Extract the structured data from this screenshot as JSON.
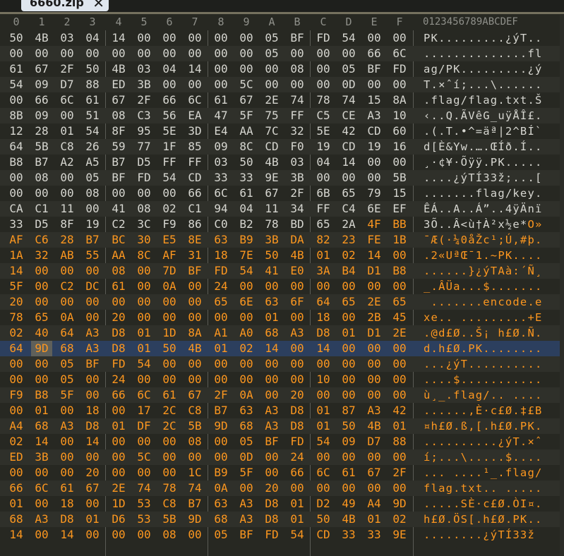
{
  "tab": {
    "title": "6660.zip"
  },
  "header": {
    "columns": [
      "0",
      "1",
      "2",
      "3",
      "4",
      "5",
      "6",
      "7",
      "8",
      "9",
      "A",
      "B",
      "C",
      "D",
      "E",
      "F"
    ],
    "ascii": "0123456789ABCDEF"
  },
  "selection": {
    "row": 20,
    "col": 1
  },
  "rows": [
    {
      "hex": [
        "50",
        "4B",
        "03",
        "04",
        "14",
        "00",
        "00",
        "00",
        "00",
        "00",
        "05",
        "BF",
        "FD",
        "54",
        "00",
        "00"
      ],
      "ascii": "PK.........¿ýT..",
      "orange_from": 16
    },
    {
      "hex": [
        "00",
        "00",
        "00",
        "00",
        "00",
        "00",
        "00",
        "00",
        "00",
        "00",
        "05",
        "00",
        "00",
        "00",
        "66",
        "6C"
      ],
      "ascii": "..............fl",
      "orange_from": 16
    },
    {
      "hex": [
        "61",
        "67",
        "2F",
        "50",
        "4B",
        "03",
        "04",
        "14",
        "00",
        "00",
        "00",
        "08",
        "00",
        "05",
        "BF",
        "FD"
      ],
      "ascii": "ag/PK.........¿ý",
      "orange_from": 16
    },
    {
      "hex": [
        "54",
        "09",
        "D7",
        "88",
        "ED",
        "3B",
        "00",
        "00",
        "00",
        "5C",
        "00",
        "00",
        "00",
        "0D",
        "00",
        "00"
      ],
      "ascii": "T.×ˆí;...\\......",
      "orange_from": 16
    },
    {
      "hex": [
        "00",
        "66",
        "6C",
        "61",
        "67",
        "2F",
        "66",
        "6C",
        "61",
        "67",
        "2E",
        "74",
        "78",
        "74",
        "15",
        "8A"
      ],
      "ascii": ".flag/flag.txt.Š",
      "orange_from": 16
    },
    {
      "hex": [
        "8B",
        "09",
        "00",
        "51",
        "08",
        "C3",
        "56",
        "EA",
        "47",
        "5F",
        "75",
        "FF",
        "C5",
        "CE",
        "A3",
        "10"
      ],
      "ascii": "‹..Q.ÃVêG_uÿÅÎ£.",
      "orange_from": 16
    },
    {
      "hex": [
        "12",
        "28",
        "01",
        "54",
        "8F",
        "95",
        "5E",
        "3D",
        "E4",
        "AA",
        "7C",
        "32",
        "5E",
        "42",
        "CD",
        "60"
      ],
      "ascii": ".(.T.•^=äª|2^BÍ`",
      "orange_from": 16
    },
    {
      "hex": [
        "64",
        "5B",
        "C8",
        "26",
        "59",
        "77",
        "1F",
        "85",
        "09",
        "8C",
        "CD",
        "F0",
        "19",
        "CD",
        "19",
        "16"
      ],
      "ascii": "d[È&Yw.….ŒÍð.Í..",
      "orange_from": 16
    },
    {
      "hex": [
        "B8",
        "B7",
        "A2",
        "A5",
        "B7",
        "D5",
        "FF",
        "FF",
        "03",
        "50",
        "4B",
        "03",
        "04",
        "14",
        "00",
        "00"
      ],
      "ascii": "¸·¢¥·Õÿÿ.PK.....",
      "orange_from": 16
    },
    {
      "hex": [
        "00",
        "08",
        "00",
        "05",
        "BF",
        "FD",
        "54",
        "CD",
        "33",
        "33",
        "9E",
        "3B",
        "00",
        "00",
        "00",
        "5B"
      ],
      "ascii": "....¿ýTÍ33ž;...[",
      "orange_from": 16
    },
    {
      "hex": [
        "00",
        "00",
        "00",
        "08",
        "00",
        "00",
        "00",
        "66",
        "6C",
        "61",
        "67",
        "2F",
        "6B",
        "65",
        "79",
        "15"
      ],
      "ascii": ".......flag/key.",
      "orange_from": 16
    },
    {
      "hex": [
        "CA",
        "C1",
        "11",
        "00",
        "41",
        "08",
        "02",
        "C1",
        "94",
        "04",
        "11",
        "34",
        "FF",
        "C4",
        "6E",
        "EF"
      ],
      "ascii": "ÊÁ..A..Á”..4ÿÄnï",
      "orange_from": 16
    },
    {
      "hex": [
        "33",
        "D5",
        "8F",
        "19",
        "C2",
        "3C",
        "F9",
        "86",
        "C0",
        "B2",
        "78",
        "BD",
        "65",
        "2A",
        "4F",
        "BB"
      ],
      "ascii": "3Õ..Â<ù†À²x½e*O»",
      "orange_from": 14
    },
    {
      "hex": [
        "AF",
        "C6",
        "28",
        "B7",
        "BC",
        "30",
        "E5",
        "8E",
        "63",
        "B9",
        "3B",
        "DA",
        "82",
        "23",
        "FE",
        "1B"
      ],
      "ascii": "¯Æ(·¼0åŽc¹;Ú‚#þ.",
      "orange_from": 0
    },
    {
      "hex": [
        "1A",
        "32",
        "AB",
        "55",
        "AA",
        "8C",
        "AF",
        "31",
        "18",
        "7E",
        "50",
        "4B",
        "01",
        "02",
        "14",
        "00"
      ],
      "ascii": ".2«UªŒ¯1.~PK....",
      "orange_from": 0
    },
    {
      "hex": [
        "14",
        "00",
        "00",
        "00",
        "08",
        "00",
        "7D",
        "BF",
        "FD",
        "54",
        "41",
        "E0",
        "3A",
        "B4",
        "D1",
        "B8"
      ],
      "ascii": "......}¿ýTAà:´Ñ¸",
      "orange_from": 0
    },
    {
      "hex": [
        "5F",
        "00",
        "C2",
        "DC",
        "61",
        "00",
        "0A",
        "00",
        "24",
        "00",
        "00",
        "00",
        "00",
        "00",
        "00",
        "00"
      ],
      "ascii": "_.ÂÜa...$.......",
      "orange_from": 0
    },
    {
      "hex": [
        "20",
        "00",
        "00",
        "00",
        "00",
        "00",
        "00",
        "00",
        "65",
        "6E",
        "63",
        "6F",
        "64",
        "65",
        "2E",
        "65"
      ],
      "ascii": " .......encode.e",
      "orange_from": 0
    },
    {
      "hex": [
        "78",
        "65",
        "0A",
        "00",
        "20",
        "00",
        "00",
        "00",
        "00",
        "00",
        "01",
        "00",
        "18",
        "00",
        "2B",
        "45"
      ],
      "ascii": "xe.. .........+E",
      "orange_from": 0
    },
    {
      "hex": [
        "02",
        "40",
        "64",
        "A3",
        "D8",
        "01",
        "1D",
        "8A",
        "A1",
        "A0",
        "68",
        "A3",
        "D8",
        "01",
        "D1",
        "2E"
      ],
      "ascii": ".@d£Ø..Š¡ h£Ø.Ñ.",
      "orange_from": 0
    },
    {
      "hex": [
        "64",
        "9D",
        "68",
        "A3",
        "D8",
        "01",
        "50",
        "4B",
        "01",
        "02",
        "14",
        "00",
        "14",
        "00",
        "00",
        "00"
      ],
      "ascii": "d.h£Ø.PK........",
      "orange_from": 0
    },
    {
      "hex": [
        "00",
        "00",
        "05",
        "BF",
        "FD",
        "54",
        "00",
        "00",
        "00",
        "00",
        "00",
        "00",
        "00",
        "00",
        "00",
        "00"
      ],
      "ascii": "...¿ýT..........",
      "orange_from": 0
    },
    {
      "hex": [
        "00",
        "00",
        "05",
        "00",
        "24",
        "00",
        "00",
        "00",
        "00",
        "00",
        "00",
        "00",
        "10",
        "00",
        "00",
        "00"
      ],
      "ascii": "....$...........",
      "orange_from": 0
    },
    {
      "hex": [
        "F9",
        "B8",
        "5F",
        "00",
        "66",
        "6C",
        "61",
        "67",
        "2F",
        "0A",
        "00",
        "20",
        "00",
        "00",
        "00",
        "00"
      ],
      "ascii": "ù¸_.flag/.. ....",
      "orange_from": 0
    },
    {
      "hex": [
        "00",
        "01",
        "00",
        "18",
        "00",
        "17",
        "2C",
        "C8",
        "B7",
        "63",
        "A3",
        "D8",
        "01",
        "87",
        "A3",
        "42"
      ],
      "ascii": "......,È·c£Ø.‡£B",
      "orange_from": 0
    },
    {
      "hex": [
        "A4",
        "68",
        "A3",
        "D8",
        "01",
        "DF",
        "2C",
        "5B",
        "9D",
        "68",
        "A3",
        "D8",
        "01",
        "50",
        "4B",
        "01"
      ],
      "ascii": "¤h£Ø.ß,[.h£Ø.PK.",
      "orange_from": 0
    },
    {
      "hex": [
        "02",
        "14",
        "00",
        "14",
        "00",
        "00",
        "00",
        "08",
        "00",
        "05",
        "BF",
        "FD",
        "54",
        "09",
        "D7",
        "88"
      ],
      "ascii": "..........¿ýT.×ˆ",
      "orange_from": 0
    },
    {
      "hex": [
        "ED",
        "3B",
        "00",
        "00",
        "00",
        "5C",
        "00",
        "00",
        "00",
        "0D",
        "00",
        "24",
        "00",
        "00",
        "00",
        "00"
      ],
      "ascii": "í;...\\.....$....",
      "orange_from": 0
    },
    {
      "hex": [
        "00",
        "00",
        "00",
        "20",
        "00",
        "00",
        "00",
        "1C",
        "B9",
        "5F",
        "00",
        "66",
        "6C",
        "61",
        "67",
        "2F"
      ],
      "ascii": "... ....¹_.flag/",
      "orange_from": 0
    },
    {
      "hex": [
        "66",
        "6C",
        "61",
        "67",
        "2E",
        "74",
        "78",
        "74",
        "0A",
        "00",
        "20",
        "00",
        "00",
        "00",
        "00",
        "00"
      ],
      "ascii": "flag.txt.. .....",
      "orange_from": 0
    },
    {
      "hex": [
        "01",
        "00",
        "18",
        "00",
        "1D",
        "53",
        "C8",
        "B7",
        "63",
        "A3",
        "D8",
        "01",
        "D2",
        "49",
        "A4",
        "9D"
      ],
      "ascii": ".....SÈ·c£Ø.ÒI¤.",
      "orange_from": 0
    },
    {
      "hex": [
        "68",
        "A3",
        "D8",
        "01",
        "D6",
        "53",
        "5B",
        "9D",
        "68",
        "A3",
        "D8",
        "01",
        "50",
        "4B",
        "01",
        "02"
      ],
      "ascii": "h£Ø.ÖS[.h£Ø.PK..",
      "orange_from": 0
    },
    {
      "hex": [
        "14",
        "00",
        "14",
        "00",
        "00",
        "00",
        "08",
        "00",
        "05",
        "BF",
        "FD",
        "54",
        "CD",
        "33",
        "33",
        "9E"
      ],
      "ascii": "........¿ýTÍ33ž",
      "orange_from": 0
    }
  ]
}
